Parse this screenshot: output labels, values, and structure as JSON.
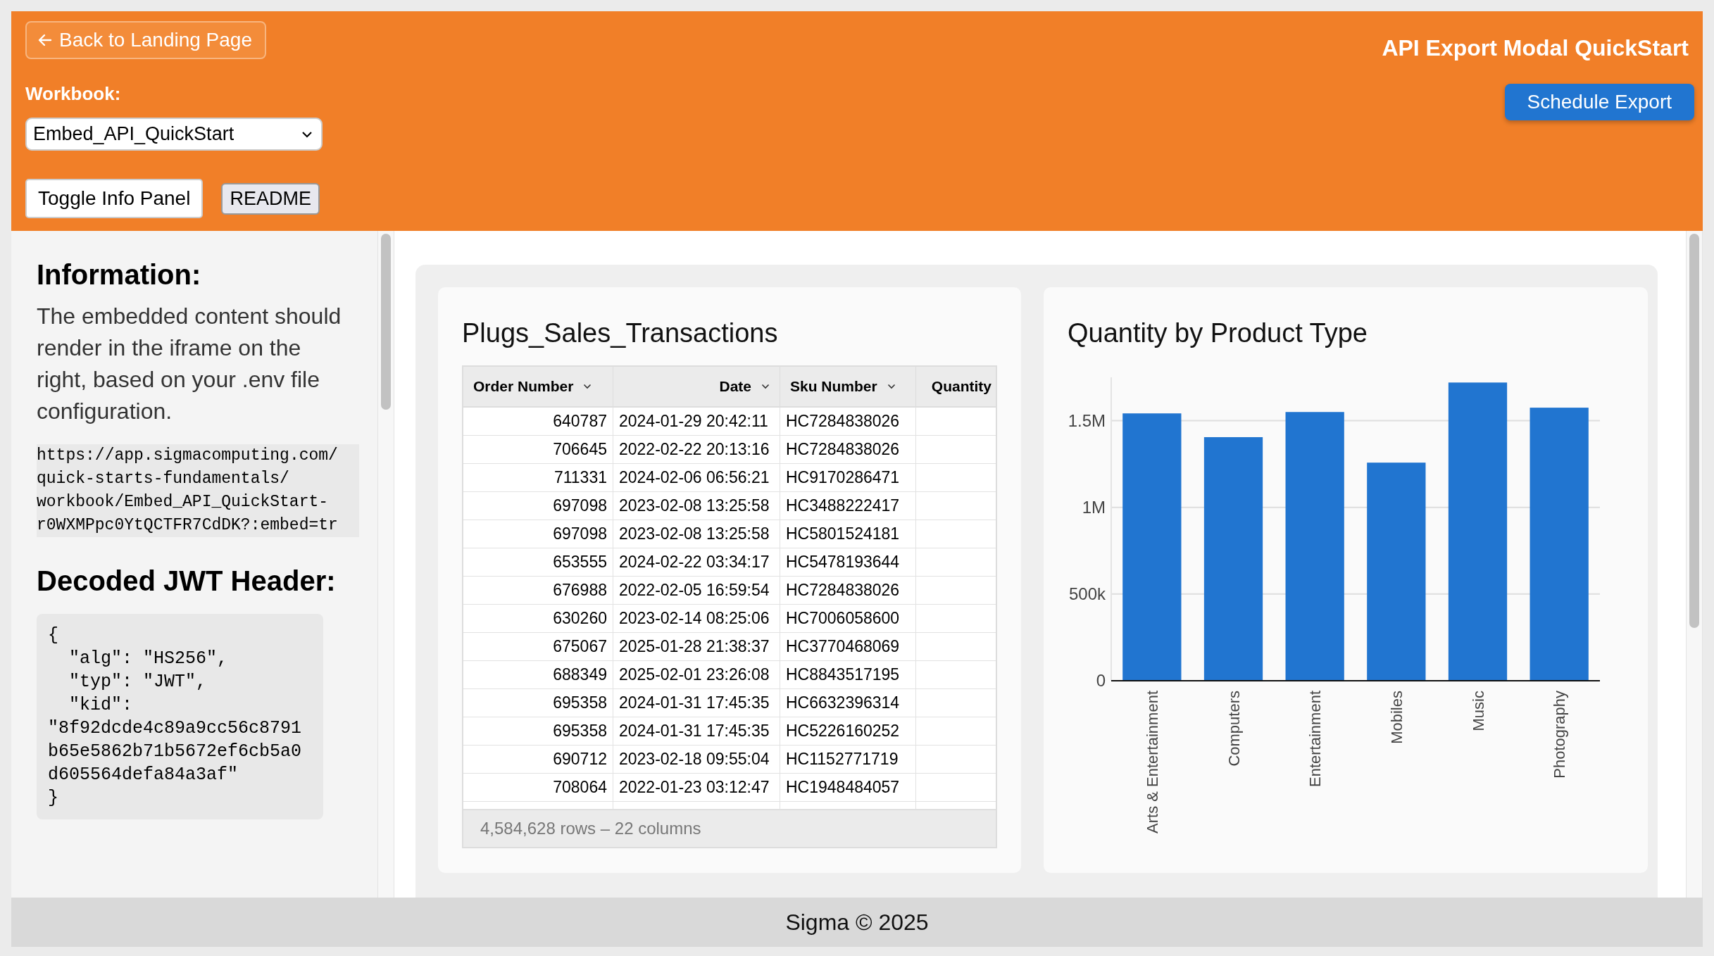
{
  "header": {
    "back_button": "Back to Landing Page",
    "workbook_label": "Workbook:",
    "workbook_select": "Embed_API_QuickStart",
    "buttons": [
      "Toggle Info Panel",
      "README"
    ],
    "title": "API Export Modal QuickStart",
    "schedule_button": "Schedule Export"
  },
  "info_panel": {
    "heading": "Information:",
    "text": "The embedded content should render in the iframe on the right, based on your .env file configuration.",
    "url": "https://app.sigmacomputing.com/quick-starts-fundamentals/workbook/Embed_API_QuickStart-r0WXMPpc0YtQCTFR7CdDK?:embed=tr",
    "jwt_heading": "Decoded JWT Header:",
    "jwt_code": "{\n  \"alg\": \"HS256\",\n  \"typ\": \"JWT\",\n  \"kid\": \"8f92dcde4c89a9cc56c8791b65e5862b71b5672ef6cb5a0d605564defa84a3af\"\n}"
  },
  "table": {
    "title": "Plugs_Sales_Transactions",
    "columns": [
      {
        "label": "Order Number",
        "menu": true
      },
      {
        "label": "Date",
        "menu": true
      },
      {
        "label": "Sku Number",
        "menu": true
      },
      {
        "label": "Quantity",
        "menu": false
      }
    ],
    "rows": [
      [
        "640787",
        "2024-01-29 20:42:11",
        "HC7284838026"
      ],
      [
        "706645",
        "2022-02-22 20:13:16",
        "HC7284838026"
      ],
      [
        "711331",
        "2024-02-06 06:56:21",
        "HC9170286471"
      ],
      [
        "697098",
        "2023-02-08 13:25:58",
        "HC3488222417"
      ],
      [
        "697098",
        "2023-02-08 13:25:58",
        "HC5801524181"
      ],
      [
        "653555",
        "2024-02-22 03:34:17",
        "HC5478193644"
      ],
      [
        "676988",
        "2022-02-05 16:59:54",
        "HC7284838026"
      ],
      [
        "630260",
        "2023-02-14 08:25:06",
        "HC7006058600"
      ],
      [
        "675067",
        "2025-01-28 21:38:37",
        "HC3770468069"
      ],
      [
        "688349",
        "2025-02-01 23:26:08",
        "HC8843517195"
      ],
      [
        "695358",
        "2024-01-31 17:45:35",
        "HC6632396314"
      ],
      [
        "695358",
        "2024-01-31 17:45:35",
        "HC5226160252"
      ],
      [
        "690712",
        "2023-02-18 09:55:04",
        "HC1152771719"
      ],
      [
        "708064",
        "2022-01-23 03:12:47",
        "HC1948484057"
      ]
    ],
    "footer": "4,584,628 rows – 22 columns"
  },
  "chart": {
    "title": "Quantity by Product Type",
    "chart_data": {
      "type": "bar",
      "categories": [
        "Arts & Entertainment",
        "Computers",
        "Entertainment",
        "Mobiles",
        "Music",
        "Photography"
      ],
      "ylim": [
        0,
        1750000
      ],
      "series": [
        {
          "color": "#2175d0",
          "values": [
            1542000,
            1405000,
            1550000,
            1258000,
            1720000,
            1575000
          ]
        }
      ],
      "grid": true,
      "yticks": [
        {
          "value": 0,
          "label": "0"
        },
        {
          "value": 500000,
          "label": "500k"
        },
        {
          "value": 1000000,
          "label": "1M"
        },
        {
          "value": 1500000,
          "label": "1.5M"
        }
      ]
    }
  },
  "footer": "Sigma © 2025"
}
